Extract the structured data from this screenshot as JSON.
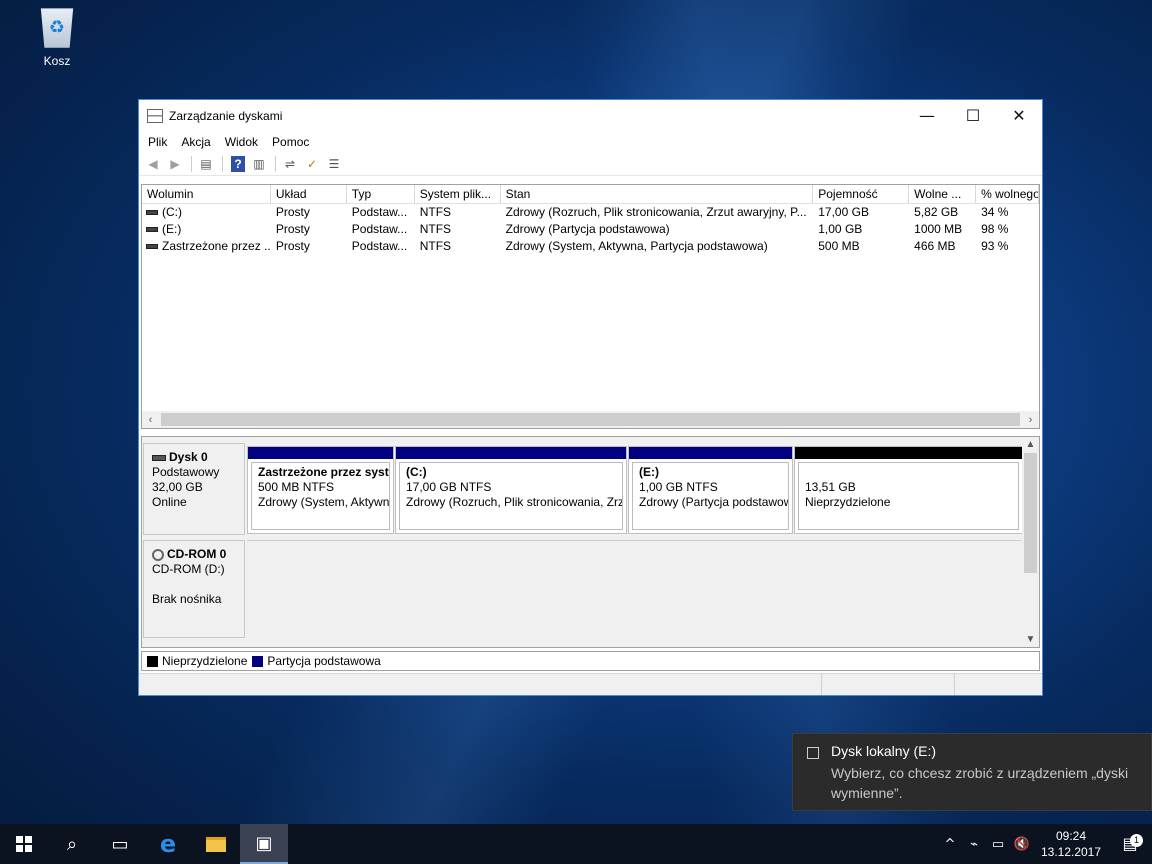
{
  "desktop": {
    "recycle_bin_label": "Kosz"
  },
  "window": {
    "title": "Zarządzanie dyskami",
    "minimize_glyph": "—",
    "maximize_glyph": "☐",
    "close_glyph": "✕"
  },
  "menu": [
    "Plik",
    "Akcja",
    "Widok",
    "Pomoc"
  ],
  "toolbar": {
    "back_icon": "arrow-left-icon",
    "forward_icon": "arrow-right-icon",
    "help_glyph": "?"
  },
  "volumes": {
    "columns": [
      "Wolumin",
      "Układ",
      "Typ",
      "System plik...",
      "Stan",
      "Pojemność",
      "Wolne ...",
      "% wolnego"
    ],
    "rows": [
      [
        "(C:)",
        "Prosty",
        "Podstaw...",
        "NTFS",
        "Zdrowy (Rozruch, Plik stronicowania, Zrzut awaryjny, P...",
        "17,00 GB",
        "5,82 GB",
        "34 %"
      ],
      [
        "(E:)",
        "Prosty",
        "Podstaw...",
        "NTFS",
        "Zdrowy (Partycja podstawowa)",
        "1,00 GB",
        "1000 MB",
        "98 %"
      ],
      [
        "Zastrzeżone przez ...",
        "Prosty",
        "Podstaw...",
        "NTFS",
        "Zdrowy (System, Aktywna, Partycja podstawowa)",
        "500 MB",
        "466 MB",
        "93 %"
      ]
    ]
  },
  "disks": {
    "disk0": {
      "name": "Dysk 0",
      "type": "Podstawowy",
      "size": "32,00 GB",
      "status": "Online",
      "partitions": [
        {
          "name": "Zastrzeżone przez syste",
          "size": "500 MB NTFS",
          "status": "Zdrowy (System, Aktywn"
        },
        {
          "name": "(C:)",
          "size": "17,00 GB NTFS",
          "status": "Zdrowy (Rozruch, Plik stronicowania, Zrz"
        },
        {
          "name": "(E:)",
          "size": "1,00 GB NTFS",
          "status": "Zdrowy (Partycja podstawow"
        },
        {
          "name": "",
          "size": "13,51 GB",
          "status": "Nieprzydzielone"
        }
      ]
    },
    "cdrom0": {
      "name": "CD-ROM 0",
      "drive": "CD-ROM (D:)",
      "media": "Brak nośnika"
    }
  },
  "legend": [
    {
      "label": "Nieprzydzielone",
      "color": "#000000"
    },
    {
      "label": "Partycja podstawowa",
      "color": "#000080"
    }
  ],
  "toast": {
    "title": "Dysk lokalny (E:)",
    "body": "Wybierz, co chcesz zrobić z urządzeniem „dyski wymienne”."
  },
  "taskbar": {
    "time": "09:24",
    "date": "13.12.2017",
    "notification_count": "1"
  }
}
